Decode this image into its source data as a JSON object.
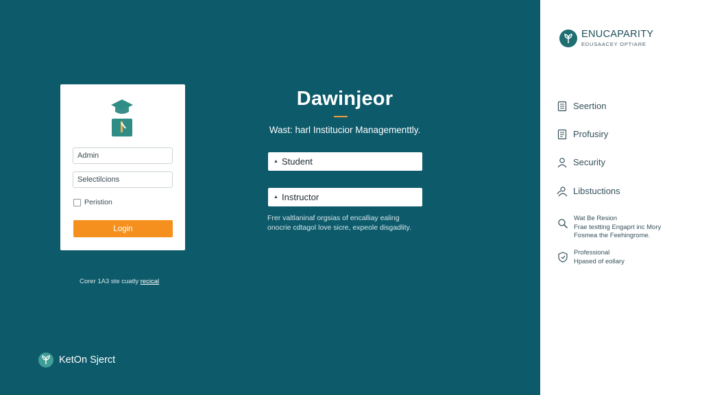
{
  "login_card": {
    "admin_placeholder": "Admin",
    "second_placeholder": "Selectilcions",
    "remember_label": "Peristion",
    "login_button": "Login"
  },
  "below_card": {
    "text": "Corer 1A3 ste cuatly",
    "link": "recical"
  },
  "hero": {
    "title": "Dawinjeor",
    "subtitle": "Wast: harl Institucior Managementtly."
  },
  "roles": [
    {
      "label": "Student",
      "icon": "caret-icon"
    },
    {
      "label": "Instructor",
      "icon": "caret-icon"
    }
  ],
  "description": {
    "line1": "Frer valtlaninaf orgsias of encalliay ealing",
    "line2": "onocrie cdtagol love sicre, expeole disgadlity."
  },
  "brand_bottom": {
    "name": "KetOn Sjerct"
  },
  "right_panel": {
    "brand_name": "ENUCAPARITY",
    "brand_sub": "EDUSAACEY OPTIARE",
    "nav": [
      {
        "label": "Seertion",
        "icon": "document-icon"
      },
      {
        "label": "Profusiry",
        "icon": "document-icon"
      },
      {
        "label": "Security",
        "icon": "user-icon"
      },
      {
        "label": "Libstuctions",
        "icon": "users-icon"
      }
    ],
    "info": [
      {
        "icon": "search-icon",
        "lines": [
          "Wat Be Resion",
          "Frae testting Engaprt inc Mory",
          "Fosmea the Feehingrome."
        ]
      },
      {
        "icon": "shield-icon",
        "lines": [
          "Professional",
          "Hpased of eollary"
        ]
      }
    ]
  },
  "colors": {
    "main_bg": "#0d5a6b",
    "accent": "#f5901e",
    "panel_bg": "#ffffff",
    "teal_icon": "#3f9e95"
  }
}
